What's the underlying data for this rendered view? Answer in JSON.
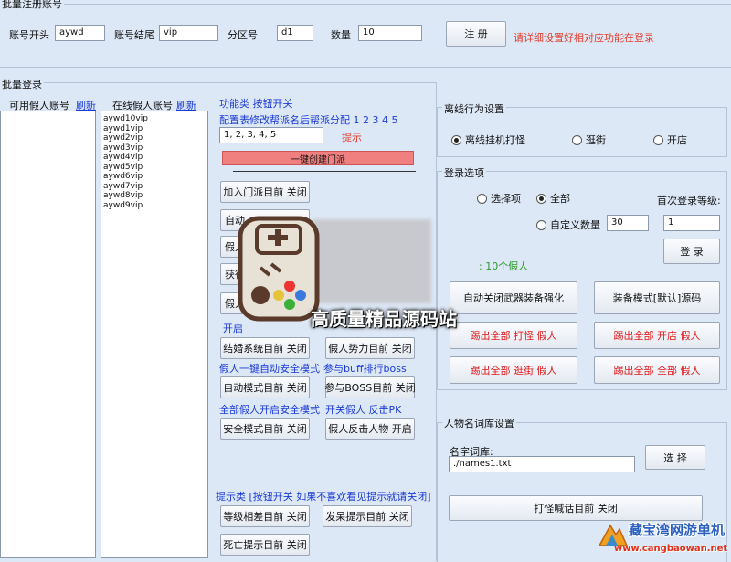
{
  "batch_register": {
    "title": "批量注册账号",
    "prefix_label": "账号开头",
    "prefix_value": "aywd",
    "suffix_label": "账号结尾",
    "suffix_value": "vip",
    "zone_label": "分区号",
    "zone_value": "d1",
    "count_label": "数量",
    "count_value": "10",
    "register_btn": "注 册",
    "hint": "请详细设置好相对应功能在登录"
  },
  "batch_login": {
    "title": "批量登录",
    "available_label": "可用假人账号",
    "available_refresh": "刷新",
    "online_label": "在线假人账号",
    "online_refresh": "刷新",
    "online_accounts": [
      "aywd10vip",
      "aywd1vip",
      "aywd2vip",
      "aywd3vip",
      "aywd4vip",
      "aywd5vip",
      "aywd6vip",
      "aywd7vip",
      "aywd8vip",
      "aywd9vip"
    ]
  },
  "functions": {
    "header": "功能类 按钮开关",
    "config_label": "配置表修改帮派名后帮派分配 1 2 3 4 5",
    "config_value": "1, 2, 3, 4, 5",
    "hint_link": "提示",
    "create_sect_btn": "一键创建门派",
    "join_sect_btn": "加入门派目前 关闭",
    "btn_auto": "自动",
    "btn_fake": "假人",
    "btn_get": "获得",
    "btn_fake2": "假人",
    "open_label": "开启",
    "marriage_btn": "结婚系统目前 关闭",
    "faction_btn": "假人势力目前 关闭",
    "auto_safe_label": "假人一键自动安全模式",
    "buff_label": "参与buff排行boss",
    "auto_mode_btn": "自动模式目前 关闭",
    "boss_btn": "参与BOSS目前 关闭",
    "all_safe_label": "全部假人开启安全模式",
    "pk_label": "开关假人 反击PK",
    "safe_mode_btn": "安全模式目前 关闭",
    "counter_btn": "假人反击人物 开启",
    "tip_label": "提示类 [按钮开关 如果不喜欢看见提示就请关闭]",
    "level_tip_btn": "等级相差目前 关闭",
    "reward_tip_btn": "发呆提示目前 关闭",
    "death_tip_btn": "死亡提示目前 关闭"
  },
  "offline": {
    "title": "离线行为设置",
    "options": [
      "离线挂机打怪",
      "逛街",
      "开店"
    ],
    "selected": 0
  },
  "login_options": {
    "title": "登录选项",
    "opt_select": "选择项",
    "opt_all": "全部",
    "first_level_label": "首次登录等级:",
    "custom_count_label": "自定义数量",
    "count_value": "30",
    "level_value": "1",
    "login_btn": "登 录",
    "fake_count": ": 10个假人",
    "weapon_btn": "自动关闭武器装备强化",
    "equip_mode_btn": "装备模式[默认]源码",
    "kick_fight_btn": "踢出全部 打怪 假人",
    "kick_shop_btn": "踢出全部 开店 假人",
    "kick_stroll_btn": "踢出全部 逛街 假人",
    "kick_all_btn": "踢出全部 全部 假人"
  },
  "name_lib": {
    "title": "人物名词库设置",
    "label": "名字词库:",
    "path": "./names1.txt",
    "select_btn": "选 择",
    "shout_btn": "打怪喊话目前 关闭"
  },
  "watermark": {
    "center_text": "高质量精品源码站",
    "logo_text": "藏宝湾网游单机",
    "logo_url": "www.cangbaowan.net"
  }
}
